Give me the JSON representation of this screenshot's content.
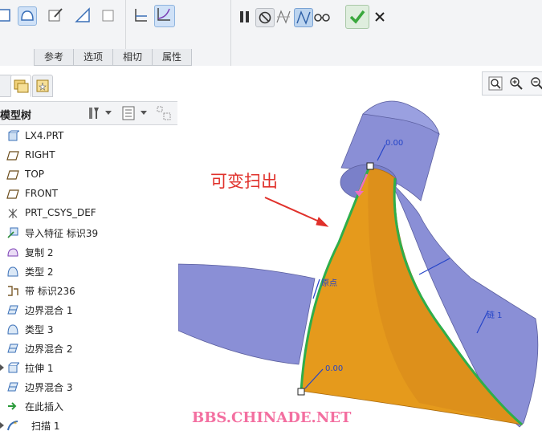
{
  "ribbon": {
    "tabs": [
      "参考",
      "选项",
      "相切",
      "属性"
    ]
  },
  "tree": {
    "title": "模型树",
    "items": [
      {
        "label": "LX4.PRT",
        "icon": "part-icon"
      },
      {
        "label": "RIGHT",
        "icon": "datum-plane-icon"
      },
      {
        "label": "TOP",
        "icon": "datum-plane-icon"
      },
      {
        "label": "FRONT",
        "icon": "datum-plane-icon"
      },
      {
        "label": "PRT_CSYS_DEF",
        "icon": "csys-icon"
      },
      {
        "label": "导入特征 标识39",
        "icon": "import-feature-icon"
      },
      {
        "label": "复制 2",
        "icon": "copy-icon"
      },
      {
        "label": "类型 2",
        "icon": "surface-icon"
      },
      {
        "label": "带 标识236",
        "icon": "band-icon"
      },
      {
        "label": "边界混合 1",
        "icon": "boundary-blend-icon"
      },
      {
        "label": "类型 3",
        "icon": "surface-icon"
      },
      {
        "label": "边界混合 2",
        "icon": "boundary-blend-icon"
      },
      {
        "label": "拉伸 1",
        "icon": "extrude-icon"
      },
      {
        "label": "边界混合 3",
        "icon": "boundary-blend-icon"
      },
      {
        "label": "在此插入",
        "icon": "insert-here-icon"
      },
      {
        "label": "扫描 1",
        "icon": "sweep-icon"
      }
    ]
  },
  "graphics": {
    "callout": "可变扫出",
    "dim_top": "0.00",
    "dim_bottom": "0.00",
    "origin_label": "原点",
    "chain_label": "链 1",
    "watermark": "BBS.CHINADE.NET"
  },
  "colors": {
    "surface_blue": "#8a8fd6",
    "sweep_orange": "#e59a1c",
    "chain_green": "#2fae4a",
    "callout_red": "#e0312b",
    "confirm_green": "#3aa83d"
  }
}
